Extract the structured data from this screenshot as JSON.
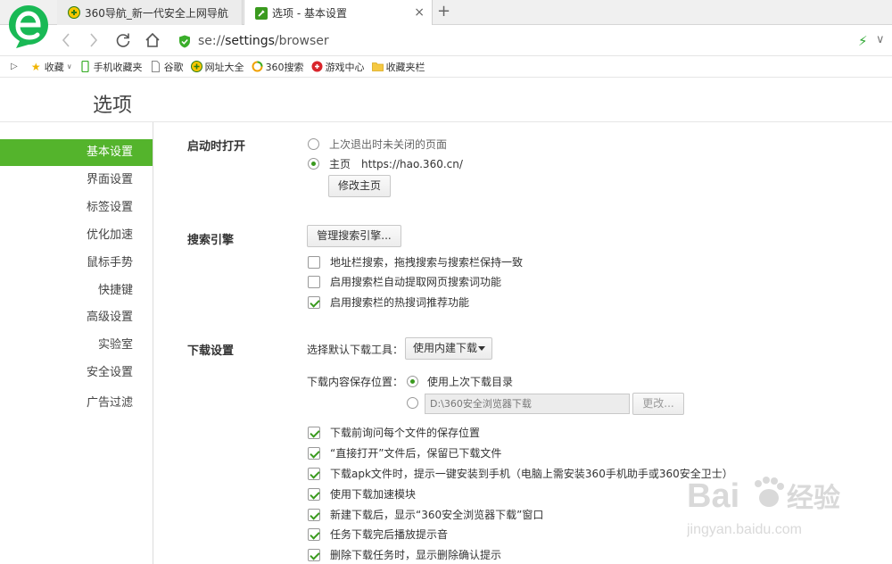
{
  "browser": {
    "tabs": [
      {
        "title": "360导航_新一代安全上网导航",
        "active": false
      },
      {
        "title": "选项 - 基本设置",
        "active": true
      }
    ],
    "new_tab": "+",
    "tab_close": "×",
    "url_scheme": "se://",
    "url_host": "settings",
    "url_path": "/browser",
    "accent_color": "#54b42c"
  },
  "bookmarks": {
    "items": [
      {
        "label": "收藏",
        "icon": "star-icon"
      },
      {
        "label": "手机收藏夹",
        "icon": "phone-icon"
      },
      {
        "label": "谷歌",
        "icon": "page-icon"
      },
      {
        "label": "网址大全",
        "icon": "sites-icon"
      },
      {
        "label": "360搜索",
        "icon": "search360-icon"
      },
      {
        "label": "游戏中心",
        "icon": "game-icon"
      },
      {
        "label": "收藏夹栏",
        "icon": "folder-icon"
      }
    ]
  },
  "page": {
    "title": "选项"
  },
  "sidebar": {
    "items": [
      {
        "label": "基本设置",
        "active": true
      },
      {
        "label": "界面设置",
        "active": false
      },
      {
        "label": "标签设置",
        "active": false
      },
      {
        "label": "优化加速",
        "active": false
      },
      {
        "label": "鼠标手势",
        "active": false
      },
      {
        "label": "快捷键",
        "active": false
      },
      {
        "label": "高级设置",
        "active": false
      },
      {
        "label": "实验室",
        "active": false
      },
      {
        "label": "安全设置",
        "active": false
      },
      {
        "label": "广告过滤",
        "active": false
      }
    ]
  },
  "startup": {
    "label": "启动时打开",
    "option_restore": "上次退出时未关闭的页面",
    "option_home": "主页",
    "home_url": "https://hao.360.cn/",
    "selected": "home",
    "change_home_button": "修改主页"
  },
  "search": {
    "label": "搜索引擎",
    "manage_button": "管理搜索引擎...",
    "options": [
      {
        "label": "地址栏搜索，拖拽搜索与搜索栏保持一致",
        "checked": false
      },
      {
        "label": "启用搜索栏自动提取网页搜索词功能",
        "checked": false
      },
      {
        "label": "启用搜索栏的热搜词推荐功能",
        "checked": true
      }
    ]
  },
  "download": {
    "label": "下载设置",
    "tool_label": "选择默认下载工具：",
    "tool_value": "使用内建下载",
    "location_label": "下载内容保存位置：",
    "location_last": "使用上次下载目录",
    "location_path": "D:\\360安全浏览器下载",
    "change_button": "更改...",
    "options": [
      {
        "label": "下载前询问每个文件的保存位置",
        "checked": true
      },
      {
        "label": "“直接打开”文件后，保留已下载文件",
        "checked": true
      },
      {
        "label": "下载apk文件时，提示一键安装到手机（电脑上需安装360手机助手或360安全卫士）",
        "checked": true
      },
      {
        "label": "使用下载加速模块",
        "checked": true
      },
      {
        "label": "新建下载后，显示“360安全浏览器下载”窗口",
        "checked": true
      },
      {
        "label": "任务下载完后播放提示音",
        "checked": true
      },
      {
        "label": "删除下载任务时，显示删除确认提示",
        "checked": true
      }
    ]
  },
  "watermark": {
    "brand": "Bai",
    "brand_cn": "经验",
    "url": "jingyan.baidu.com"
  }
}
